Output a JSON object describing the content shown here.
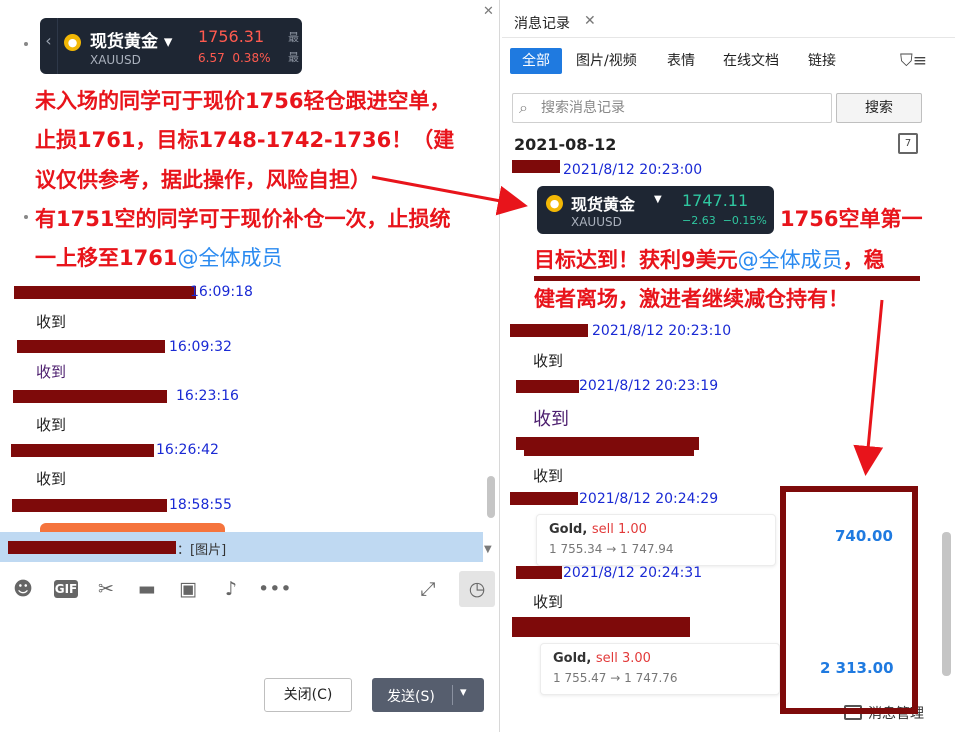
{
  "colors": {
    "accent": "#1f7ae0",
    "annotation_red": "#e8141b",
    "redact": "#7e0a0a",
    "gain_green": "#2fc7a0",
    "loss_red": "#ff5a4f"
  },
  "left": {
    "ticker": {
      "name": "现货黄金",
      "symbol": "XAUUSD",
      "price": "1756.31",
      "change": "6.57",
      "change_pct": "0.38%",
      "more": "最",
      "more2": "最"
    },
    "announce1": {
      "l1": "未入场的同学可于现价1756轻仓跟进空单，",
      "l2": "止损1761，目标1748-1742-1736！（建",
      "l3": "议仅供参考，据此操作，风险自担）"
    },
    "announce2": {
      "l1": "有1751空的同学可于现价补仓一次，止损统",
      "l2_prefix": "一上移至1761",
      "mention": "@全体成员"
    },
    "messages": [
      {
        "time": "16:09:18",
        "text": "收到"
      },
      {
        "time": "16:09:32",
        "text": "收到"
      },
      {
        "time": "16:23:16",
        "text": "收到"
      },
      {
        "time": "16:26:42",
        "text": "收到"
      },
      {
        "time": "18:58:55",
        "text": ""
      }
    ],
    "quote_text": "：[图片]",
    "buttons": {
      "close": "关闭(C)",
      "send": "发送(S)"
    }
  },
  "right": {
    "tab_title": "消息记录",
    "filters": [
      "全部",
      "图片/视频",
      "表情",
      "在线文档",
      "链接"
    ],
    "search_placeholder": "搜索消息记录",
    "search_button": "搜索",
    "date": "2021-08-12",
    "calendar_day": "7",
    "first_time": "2021/8/12 20:23:00",
    "ticker": {
      "name": "现货黄金",
      "symbol": "XAUUSD",
      "price": "1747.11",
      "change": "−2.63",
      "change_pct": "−0.15%"
    },
    "announce": {
      "l1": "1756空单第一",
      "l2_prefix": "目标达到！获利9美元",
      "mention": "@全体成员",
      "l2_suffix": "，稳",
      "l3": "健者离场，激进者继续减仓持有！"
    },
    "messages": [
      {
        "time": "2021/8/12 20:23:10",
        "text": "收到"
      },
      {
        "time": "2021/8/12 20:23:19",
        "text": "收到"
      },
      {
        "time": "",
        "text": "收到"
      },
      {
        "time": "2021/8/12 20:24:29",
        "text": ""
      },
      {
        "time": "2021/8/12 20:24:31",
        "text": "收到"
      }
    ],
    "trade1": {
      "label": "Gold,",
      "side": "sell 1.00",
      "range": "1 755.34 → 1 747.94",
      "pnl": "740.00"
    },
    "trade2": {
      "label": "Gold,",
      "side": "sell 3.00",
      "range": "1 755.47 → 1 747.76",
      "pnl": "2 313.00"
    },
    "manager": "消息管理"
  }
}
